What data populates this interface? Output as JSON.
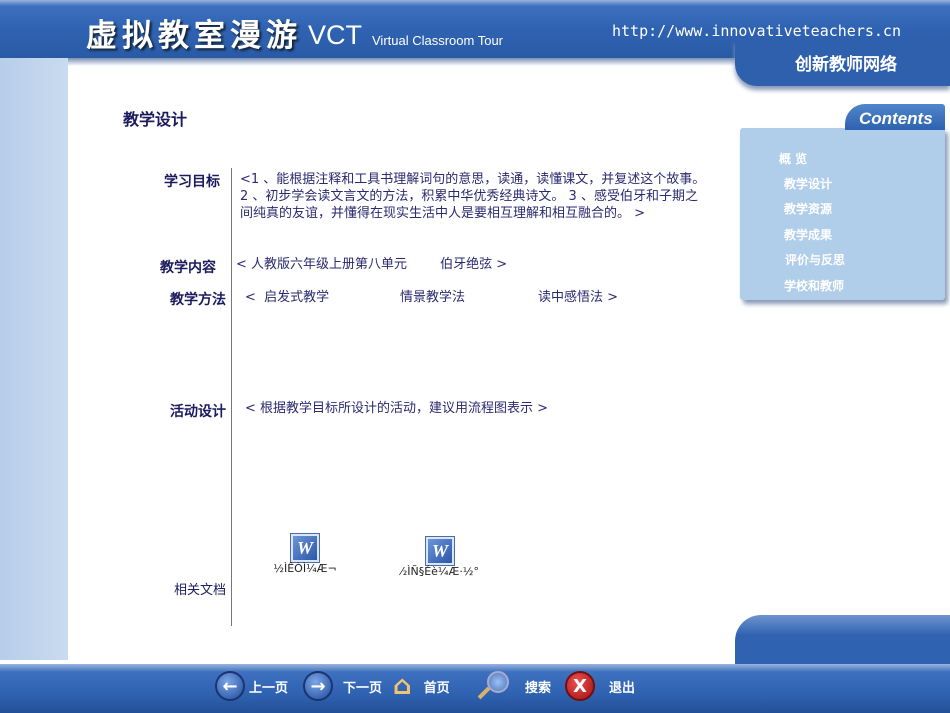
{
  "header": {
    "title_cn": "虚拟教室漫游",
    "title_abbr": "VCT",
    "title_en": "Virtual Classroom Tour",
    "url": "http://www.innovativeteachers.cn",
    "org": "创新教师网络"
  },
  "page_title": "教学设计",
  "sections": [
    {
      "label": "学习目标",
      "text": "<1 、能根据注释和工具书理解词句的意思，读通，读懂课文，并复述这个故事。 2 、初步学会读文言文的方法，积累中华优秀经典诗文。 3 、感受伯牙和子期之间纯真的友谊，并懂得在现实生活中人是要相互理解和相互融合的。 >"
    },
    {
      "label": "教学内容",
      "text": "< 人教版六年级上册第八单元        伯牙绝弦 >"
    },
    {
      "label": "教学方法",
      "parts": [
        "<  启发式教学",
        "情景教学法",
        "读中感悟法 >"
      ]
    },
    {
      "label": "活动设计",
      "text": "< 根据教学目标所设计的活动，建议用流程图表示 >"
    },
    {
      "label": "相关文档"
    }
  ],
  "documents": [
    {
      "name": "½ÌÊÒÌ¼Æ¬"
    },
    {
      "name": "⁄₂ÌÑ§Éè¼Æ·½°"
    }
  ],
  "contents": {
    "title": "Contents",
    "items": [
      "概 览",
      "教学设计",
      "教学资源",
      "教学成果",
      "评价与反思",
      "学校和教师"
    ]
  },
  "nav": {
    "prev": "上一页",
    "next": "下一页",
    "home": "首页",
    "search": "搜索",
    "exit": "退出"
  }
}
